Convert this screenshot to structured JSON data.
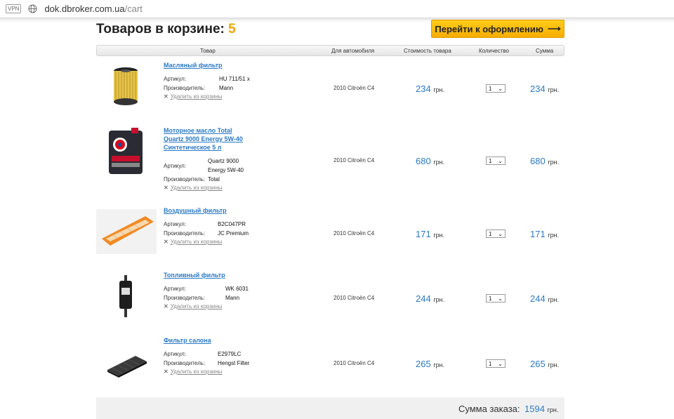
{
  "browser": {
    "vpn_label": "VPN",
    "url_host": "dok.dbroker.com.ua",
    "url_path": "/cart"
  },
  "cart": {
    "title": "Товаров в корзине:",
    "count": "5",
    "checkout_label": "Перейти к оформлению",
    "checkout_arrow": "⟶"
  },
  "table": {
    "headers": [
      "Товар",
      "Для автомобиля",
      "Стоимость товара",
      "Количество",
      "Сумма"
    ],
    "article_label": "Артикул:",
    "maker_label": "Производитель:",
    "delete_label": "Удалить из корзины",
    "currency": "грн.",
    "items": [
      {
        "name": "Масляный фильтр",
        "article": "HU 711/51 x",
        "maker": "Mann",
        "car": "2010 Citroën C4",
        "price": "234",
        "qty": "1",
        "sum": "234",
        "thumb": "oil-filter"
      },
      {
        "name": "Моторное масло Total Quartz 9000 Energy 5W-40 Синтетическое 5 л",
        "article": "Quartz 9000 Energy 5W-40",
        "maker": "Total",
        "car": "2010 Citroën C4",
        "price": "680",
        "qty": "1",
        "sum": "680",
        "thumb": "motor-oil-can"
      },
      {
        "name": "Воздушный фильтр",
        "article": "B2C047PR",
        "maker": "JC Premium",
        "car": "2010 Citroën C4",
        "price": "171",
        "qty": "1",
        "sum": "171",
        "thumb": "air-filter"
      },
      {
        "name": "Топливный фильтр",
        "article": "WK 6031",
        "maker": "Mann",
        "car": "2010 Citroën C4",
        "price": "244",
        "qty": "1",
        "sum": "244",
        "thumb": "fuel-filter"
      },
      {
        "name": "Фильтр салона",
        "article": "E2979LC",
        "maker": "Hengst Filter",
        "car": "2010 Citroën C4",
        "price": "265",
        "qty": "1",
        "sum": "265",
        "thumb": "cabin-filter"
      }
    ]
  },
  "total": {
    "label": "Сумма заказа:",
    "value": "1594",
    "currency": "грн."
  }
}
